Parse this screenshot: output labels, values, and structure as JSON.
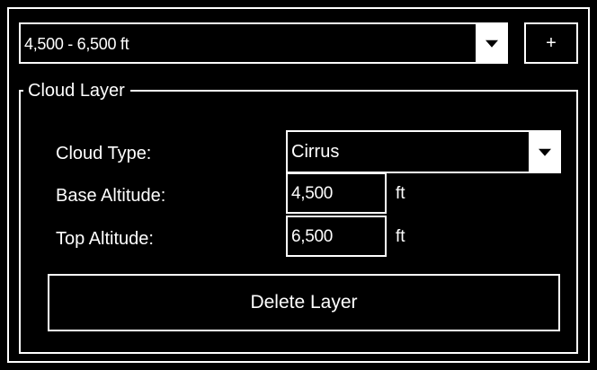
{
  "layer_selector": {
    "selected": "4,500 - 6,500 ft"
  },
  "add_button": {
    "label": "+"
  },
  "cloud_layer": {
    "title": "Cloud Layer",
    "cloud_type": {
      "label": "Cloud Type:",
      "value": "Cirrus"
    },
    "base_altitude": {
      "label": "Base Altitude:",
      "value": "4,500",
      "unit": "ft"
    },
    "top_altitude": {
      "label": "Top Altitude:",
      "value": "6,500",
      "unit": "ft"
    },
    "delete_button": {
      "label": "Delete Layer"
    }
  },
  "icons": {
    "dropdown": "chevron-down-icon",
    "add": "plus-icon"
  },
  "colors": {
    "background": "#000000",
    "foreground": "#ffffff"
  }
}
